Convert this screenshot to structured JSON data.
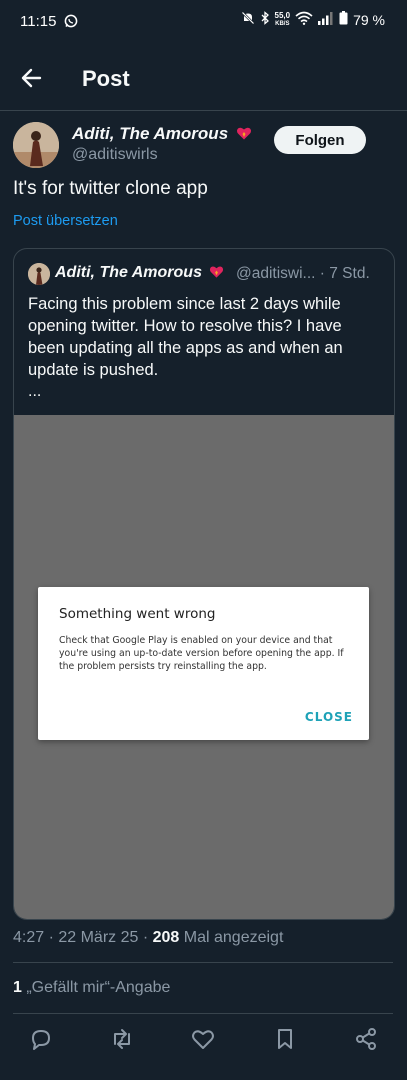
{
  "status_bar": {
    "time": "11:15",
    "speed_value": "55,0",
    "speed_unit": "KB/S",
    "battery": "79 %"
  },
  "header": {
    "title": "Post"
  },
  "post": {
    "author_name": "Aditi, The Amorous",
    "author_handle": "@aditiswirls",
    "follow_label": "Folgen",
    "text": "It's for twitter clone app",
    "translate_label": "Post übersetzen"
  },
  "quoted_post": {
    "author_name": "Aditi, The Amorous",
    "author_handle": "@aditiswi... · 7 Std.",
    "text": "Facing this problem since last 2 days while opening twitter. How to resolve this? I have been updating all the apps as and when an update is pushed.",
    "ellipsis": "...",
    "dialog": {
      "title": "Something went wrong",
      "message": "Check that Google Play is enabled on your device and that you're using an up-to-date version before opening the app. If the problem persists try reinstalling the app.",
      "close_label": "CLOSE"
    }
  },
  "meta": {
    "timestamp": "4:27 · 22 März 25 · ",
    "views_count": "208",
    "views_label": " Mal angezeigt"
  },
  "likes": {
    "count": "1",
    "label": " „Gefällt mir“-Angabe"
  },
  "colors": {
    "background": "#15202b",
    "accent": "#1d9bf0",
    "dialog_button": "#1ea2b7"
  },
  "icons": [
    "back-arrow-icon",
    "reply-icon",
    "retweet-icon",
    "like-icon",
    "bookmark-icon",
    "share-icon"
  ]
}
